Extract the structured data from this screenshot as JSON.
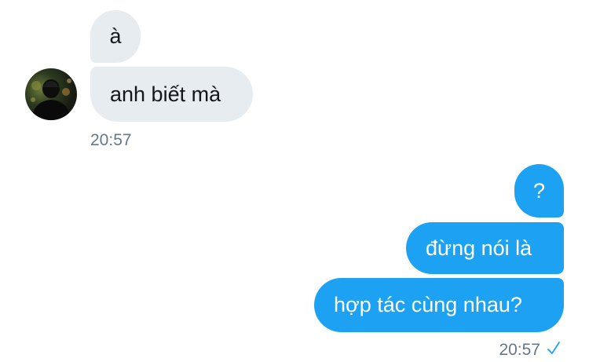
{
  "conversation": {
    "incoming": {
      "messages": [
        "à",
        "anh biết mà"
      ],
      "timestamp": "20:57",
      "avatar_icon": "user-avatar"
    },
    "outgoing": {
      "messages": [
        "?",
        "đừng nói là",
        "hợp tác cùng nhau?"
      ],
      "timestamp": "20:57",
      "status_icon": "sent-check-icon"
    }
  },
  "colors": {
    "incoming_bubble": "#e6ecf0",
    "outgoing_bubble": "#1da1f2",
    "timestamp_text": "#657786"
  }
}
